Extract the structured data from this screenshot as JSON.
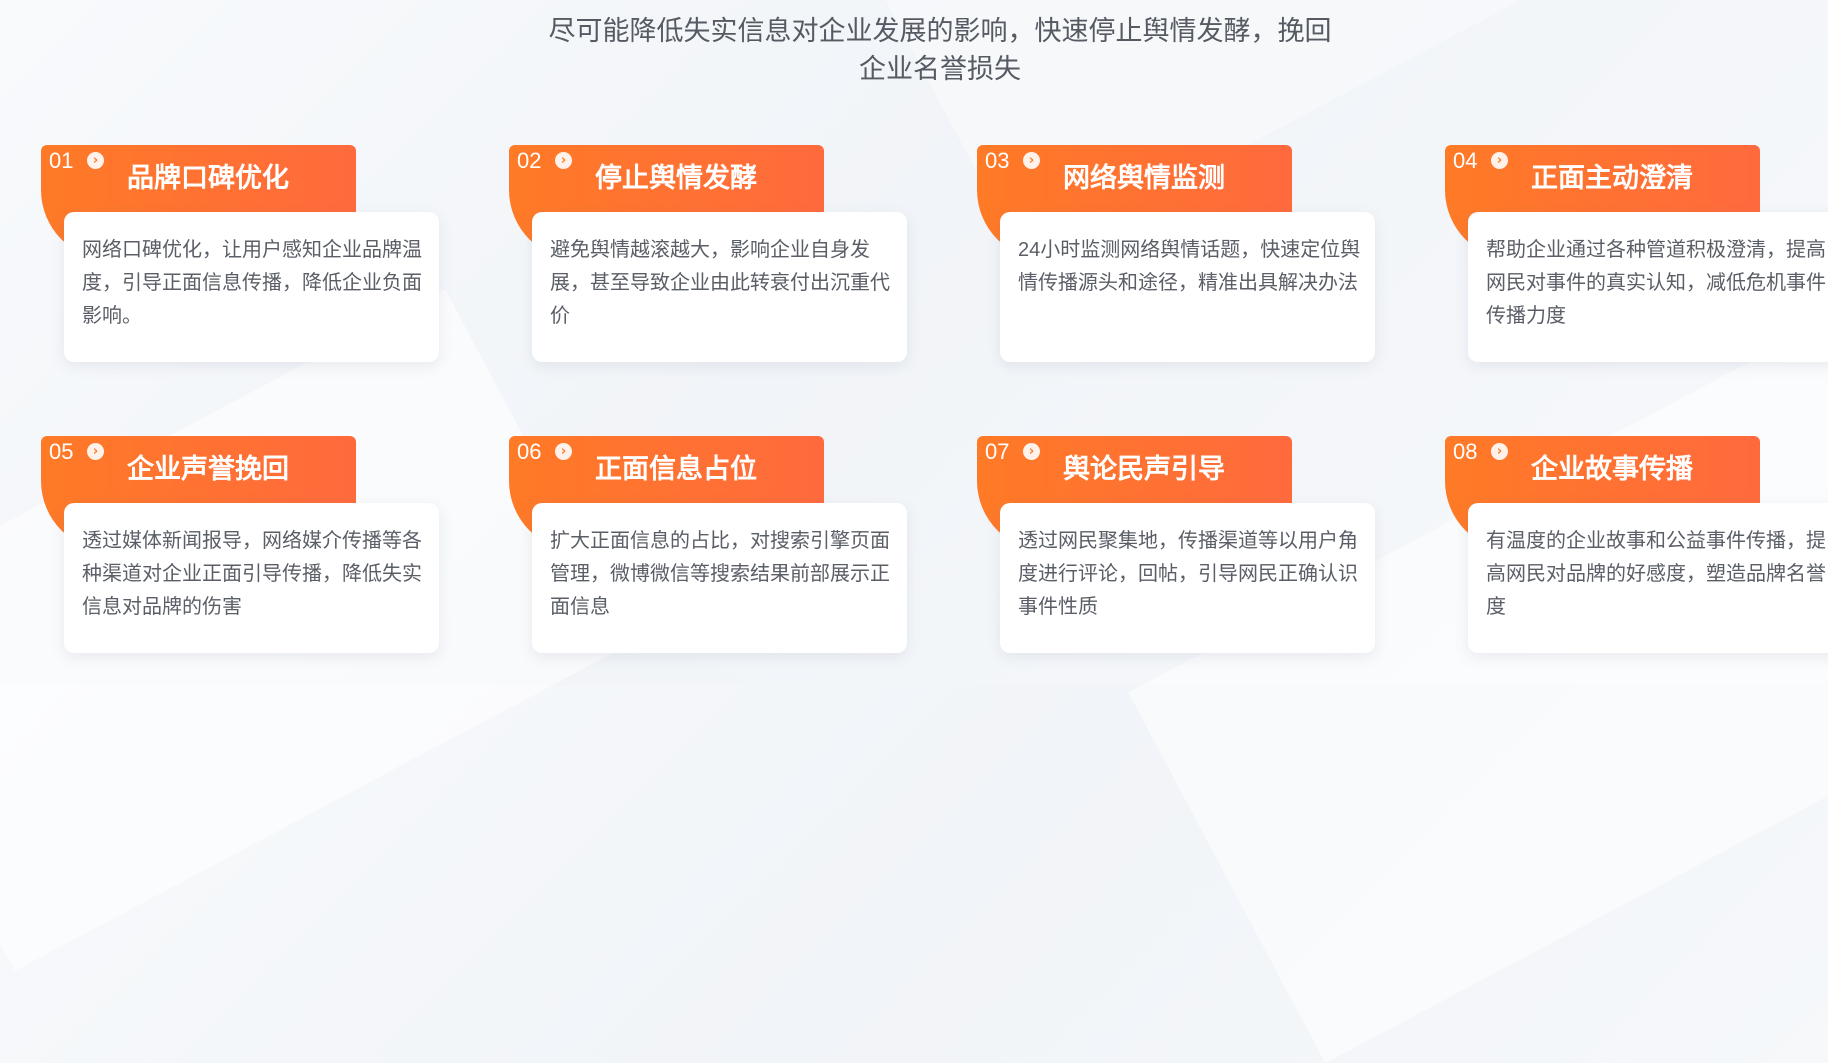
{
  "subtitle": "尽可能降低失实信息对企业发展的影响，快速停止舆情发酵，挽回企业名誉损失",
  "colors": {
    "accent_orange": "#ff7a26",
    "accent_orange_2": "#ff6a3d",
    "card_bg": "#ffffff",
    "text_body": "#5a5e66",
    "text_subtitle": "#555a63"
  },
  "icons": {
    "arrow": "chevron-right-circle-icon"
  },
  "cards": [
    {
      "num": "01",
      "title": "品牌口碑优化",
      "desc": "网络口碑优化，让用户感知企业品牌温度，引导正面信息传播，降低企业负面影响。"
    },
    {
      "num": "02",
      "title": "停止舆情发酵",
      "desc": "避免舆情越滚越大，影响企业自身发展，甚至导致企业由此转衰付出沉重代价"
    },
    {
      "num": "03",
      "title": "网络舆情监测",
      "desc": "24小时监测网络舆情话题，快速定位舆情传播源头和途径，精准出具解决办法"
    },
    {
      "num": "04",
      "title": "正面主动澄清",
      "desc": "帮助企业通过各种管道积极澄清，提高网民对事件的真实认知，减低危机事件传播力度"
    },
    {
      "num": "05",
      "title": "企业声誉挽回",
      "desc": "透过媒体新闻报导，网络媒介传播等各种渠道对企业正面引导传播，降低失实信息对品牌的伤害"
    },
    {
      "num": "06",
      "title": "正面信息占位",
      "desc": "扩大正面信息的占比，对搜索引擎页面管理，微博微信等搜索结果前部展示正面信息"
    },
    {
      "num": "07",
      "title": "舆论民声引导",
      "desc": "透过网民聚集地，传播渠道等以用户角度进行评论，回帖，引导网民正确认识事件性质"
    },
    {
      "num": "08",
      "title": "企业故事传播",
      "desc": "有温度的企业故事和公益事件传播，提高网民对品牌的好感度，塑造品牌名誉度"
    }
  ]
}
